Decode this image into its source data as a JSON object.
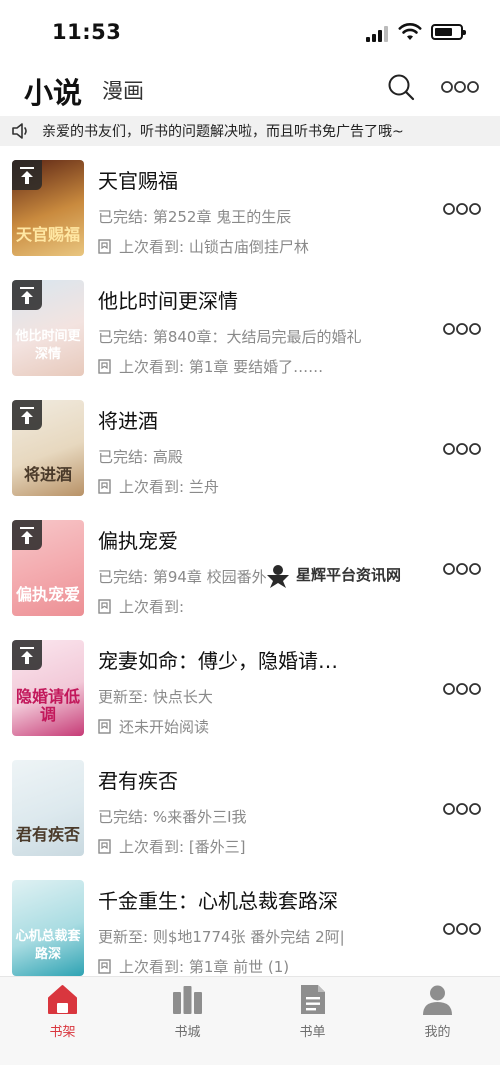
{
  "status_bar": {
    "time": "11:53",
    "battery_level": 0.7
  },
  "header": {
    "tab_novel": "小说",
    "tab_comic": "漫画",
    "search_icon": "search-icon",
    "more_icon": "more-icon"
  },
  "notice": {
    "icon": "speaker-icon",
    "text": "亲爱的书友们，听书的问题解决啦，而且听书免广告了哦~"
  },
  "books": [
    {
      "title": "天官赐福",
      "status": "已完结: 第252章 鬼王的生辰",
      "last_read": "上次看到: 山锁古庙倒挂尸林",
      "pinned": true,
      "cover_text": "天官赐福",
      "cover_colors": [
        "#5a2314",
        "#c98a3e",
        "#e9c680"
      ]
    },
    {
      "title": "他比时间更深情",
      "status": "已完结: 第840章：大结局完最后的婚礼",
      "last_read": "上次看到: 第1章 要结婚了……",
      "pinned": true,
      "cover_text": "他比时间更深情",
      "cover_colors": [
        "#d8e6ef",
        "#f3e3e0",
        "#e7c9bb"
      ]
    },
    {
      "title": "将进酒",
      "status": "已完结: 高殿",
      "last_read": "上次看到: 兰舟",
      "pinned": true,
      "cover_text": "将进酒",
      "cover_colors": [
        "#f1ebe0",
        "#e7d8bf",
        "#b89267"
      ]
    },
    {
      "title": "偏执宠爱",
      "status": "已完结: 第94章 校园番外",
      "last_read": "上次看到:",
      "pinned": true,
      "cover_text": "偏执宠爱",
      "cover_colors": [
        "#f7c7c9",
        "#f3a9ad",
        "#ec8f94"
      ]
    },
    {
      "title": "宠妻如命：傅少，隐婚请…",
      "status": "更新至: 快点长大",
      "last_read": "还未开始阅读",
      "pinned": true,
      "cover_text": "隐婚请低调",
      "cover_colors": [
        "#fbe7ef",
        "#f2c9d8",
        "#c63b76"
      ]
    },
    {
      "title": "君有疾否",
      "status": "已完结: %来番外三I我",
      "last_read": "上次看到: [番外三]",
      "pinned": false,
      "cover_text": "君有疾否",
      "cover_colors": [
        "#eef4f6",
        "#dde9ee",
        "#c9d9e0"
      ]
    },
    {
      "title": "千金重生：心机总裁套路深",
      "status": "更新至: 则$地1774张 番外完结 2阿|",
      "last_read": "上次看到: 第1章 前世 (1)",
      "pinned": false,
      "cover_text": "心机总裁套路深",
      "cover_colors": [
        "#dff1f3",
        "#a9dce2",
        "#2fa3b3"
      ]
    }
  ],
  "watermark": {
    "text": "星辉平台资讯网"
  },
  "bottom_nav": [
    {
      "label": "书架",
      "icon": "home-icon",
      "active": true
    },
    {
      "label": "书城",
      "icon": "bookstore-icon",
      "active": false
    },
    {
      "label": "书单",
      "icon": "booklist-icon",
      "active": false
    },
    {
      "label": "我的",
      "icon": "user-icon",
      "active": false
    }
  ],
  "colors": {
    "accent": "#d9363e",
    "inactive_icon": "#8e8e8e",
    "secondary_text": "#8a8a8a",
    "notice_bg": "#f1f1f1"
  }
}
